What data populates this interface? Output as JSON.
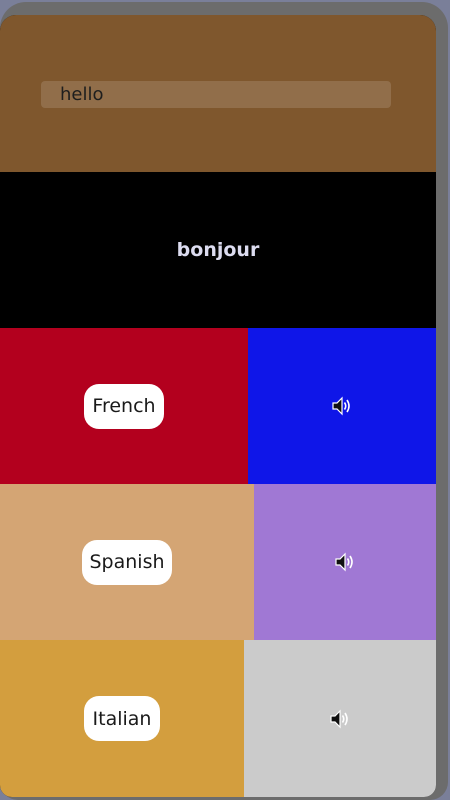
{
  "input": {
    "value": "hello"
  },
  "output": {
    "text": "bonjour"
  },
  "languages": [
    {
      "label": "French",
      "button_color": "#b3001e",
      "speak_color": "#0f16e8",
      "speak_icon": "speaker-icon"
    },
    {
      "label": "Spanish",
      "button_color": "#d4a574",
      "speak_color": "#a078d4",
      "speak_icon": "speaker-icon"
    },
    {
      "label": "Italian",
      "button_color": "#d39e3e",
      "speak_color": "#cbcbcb",
      "speak_icon": "speaker-icon"
    }
  ],
  "colors": {
    "header_bg": "#7f572d",
    "output_bg": "#000000",
    "frame": "#6c6c6c",
    "backdrop": "#7a7f99"
  }
}
